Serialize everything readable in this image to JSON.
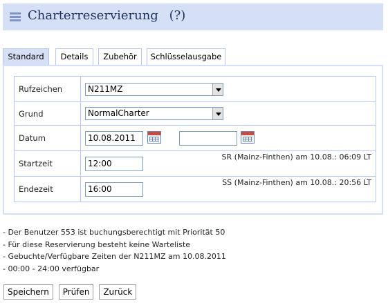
{
  "header": {
    "title": "Charterreservierung",
    "help": "(?)"
  },
  "tabs": [
    {
      "label": "Standard",
      "active": true
    },
    {
      "label": "Details"
    },
    {
      "label": "Zubehör"
    },
    {
      "label": "Schlüsselausgabe"
    }
  ],
  "form": {
    "rufzeichen": {
      "label": "Rufzeichen",
      "value": "N211MZ"
    },
    "grund": {
      "label": "Grund",
      "value": "NormalCharter"
    },
    "datum": {
      "label": "Datum",
      "value": "10.08.2011",
      "value2": ""
    },
    "startzeit": {
      "label": "Startzeit",
      "value": "12:00",
      "info": "SR (Mainz-Finthen) am 10.08.: 06:09 LT"
    },
    "endezeit": {
      "label": "Endezeit",
      "value": "16:00",
      "info": "SS (Mainz-Finthen) am 10.08.: 20:56 LT"
    }
  },
  "notes": [
    "- Der Benutzer 553 ist buchungsberechtigt mit Priorität 50",
    "- Für diese Reservierung besteht keine Warteliste",
    "- Gebuchte/Verfügbare Zeiten der N211MZ am 10.08.2011",
    "- 00:00 - 24:00 verfügbar"
  ],
  "buttons": {
    "save": "Speichern",
    "check": "Prüfen",
    "back": "Zurück"
  },
  "colors": {
    "header_bg": "#d5e0f6",
    "border": "#b7c8e8",
    "title": "#1e2f5c"
  }
}
